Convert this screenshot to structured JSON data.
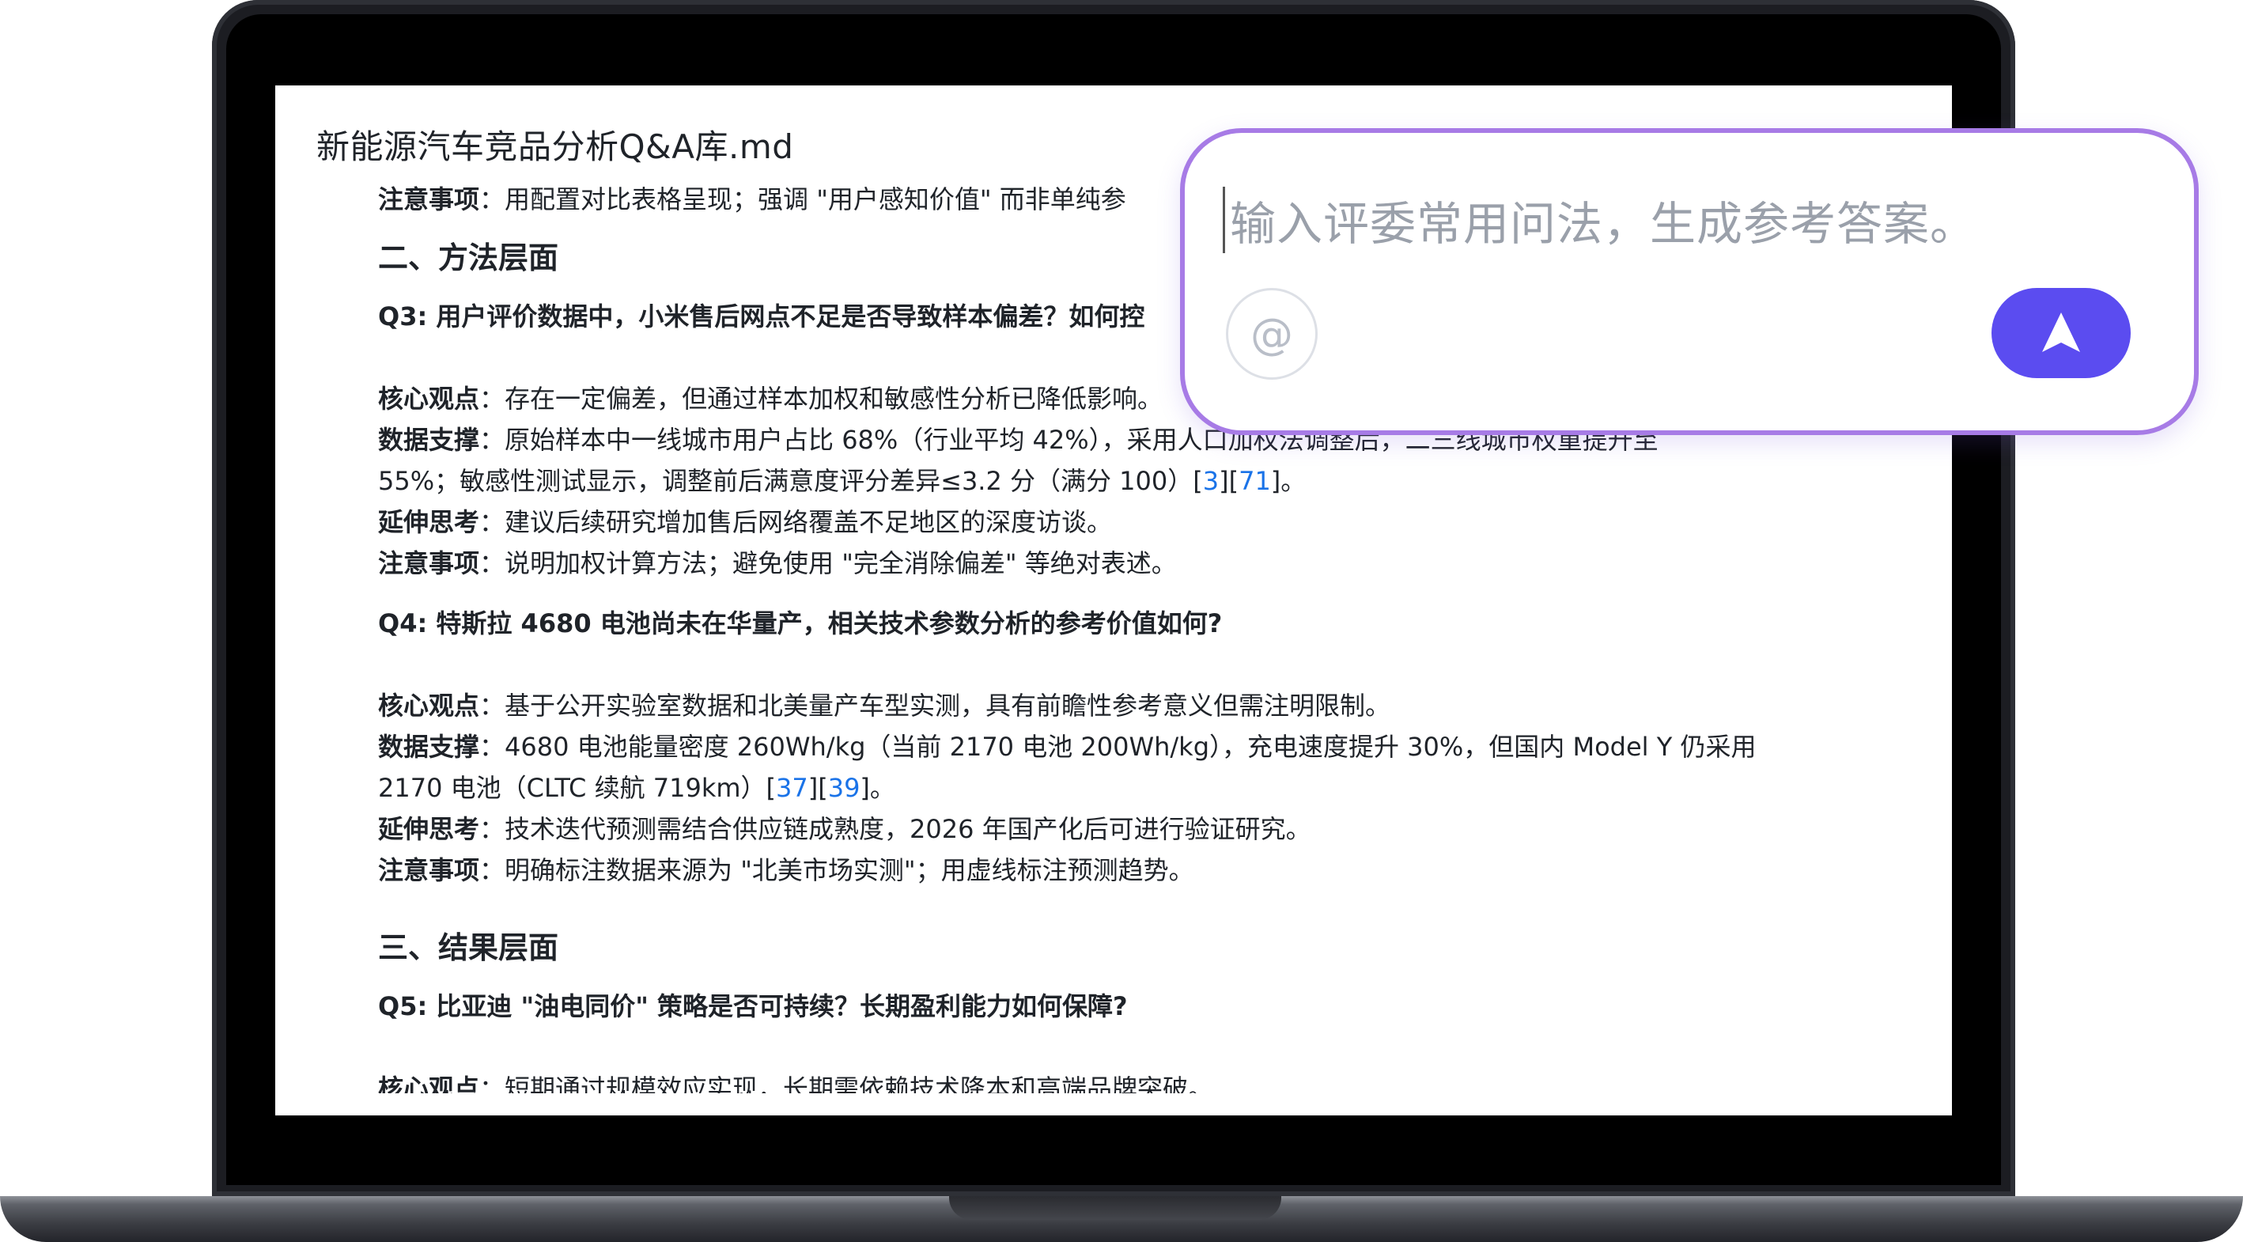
{
  "document": {
    "title": "新能源汽车竞品分析Q&A库.md",
    "lines": [
      {
        "label": "注意事项",
        "text": "：用配置对比表格呈现；强调 \"用户感知价值\" 而非单纯参"
      },
      {
        "heading": "二、方法层面"
      },
      {
        "question": "Q3: 用户评价数据中，小米售后网点不足是否导致样本偏差？如何控"
      },
      {
        "label": "核心观点",
        "text": "：存在一定偏差，但通过样本加权和敏感性分析已降低影响。"
      },
      {
        "label": "数据支撑",
        "text": "：原始样本中一线城市用户占比 68%（行业平均 42%），采用人口加权法调整后，二三线城市权重提升至"
      },
      {
        "text": "55%；敏感性测试显示，调整前后满意度评分差异≤3.2 分（满分 100）",
        "refs": [
          "3",
          "71"
        ],
        "suffix": "。"
      },
      {
        "label": "延伸思考",
        "text": "：建议后续研究增加售后网络覆盖不足地区的深度访谈。"
      },
      {
        "label": "注意事项",
        "text": "：说明加权计算方法；避免使用 \"完全消除偏差\" 等绝对表述。"
      },
      {
        "question": "Q4: 特斯拉 4680 电池尚未在华量产，相关技术参数分析的参考价值如何?"
      },
      {
        "label": "核心观点",
        "text": "：基于公开实验室数据和北美量产车型实测，具有前瞻性参考意义但需注明限制。"
      },
      {
        "label": "数据支撑",
        "text": "：4680 电池能量密度 260Wh/kg（当前 2170 电池 200Wh/kg），充电速度提升 30%，但国内 Model Y 仍采用"
      },
      {
        "text": "2170 电池（CLTC 续航 719km）",
        "refs": [
          "37",
          "39"
        ],
        "suffix": "。"
      },
      {
        "label": "延伸思考",
        "text": "：技术迭代预测需结合供应链成熟度，2026 年国产化后可进行验证研究。"
      },
      {
        "label": "注意事项",
        "text": "：明确标注数据来源为 \"北美市场实测\"；用虚线标注预测趋势。"
      },
      {
        "heading": "三、结果层面"
      },
      {
        "question": "Q5: 比亚迪 \"油电同价\" 策略是否可持续？长期盈利能力如何保障?"
      },
      {
        "label": "核心观点",
        "text": "：短期通过规模效应实现，长期需依赖技术降本和高端品牌突破。"
      }
    ]
  },
  "prompt": {
    "placeholder": "输入评委常用问法，生成参考答案。",
    "at_symbol": "@"
  },
  "colors": {
    "accent": "#5b4cf0",
    "border_gradient": "#a77be6",
    "link": "#1a73e8"
  }
}
